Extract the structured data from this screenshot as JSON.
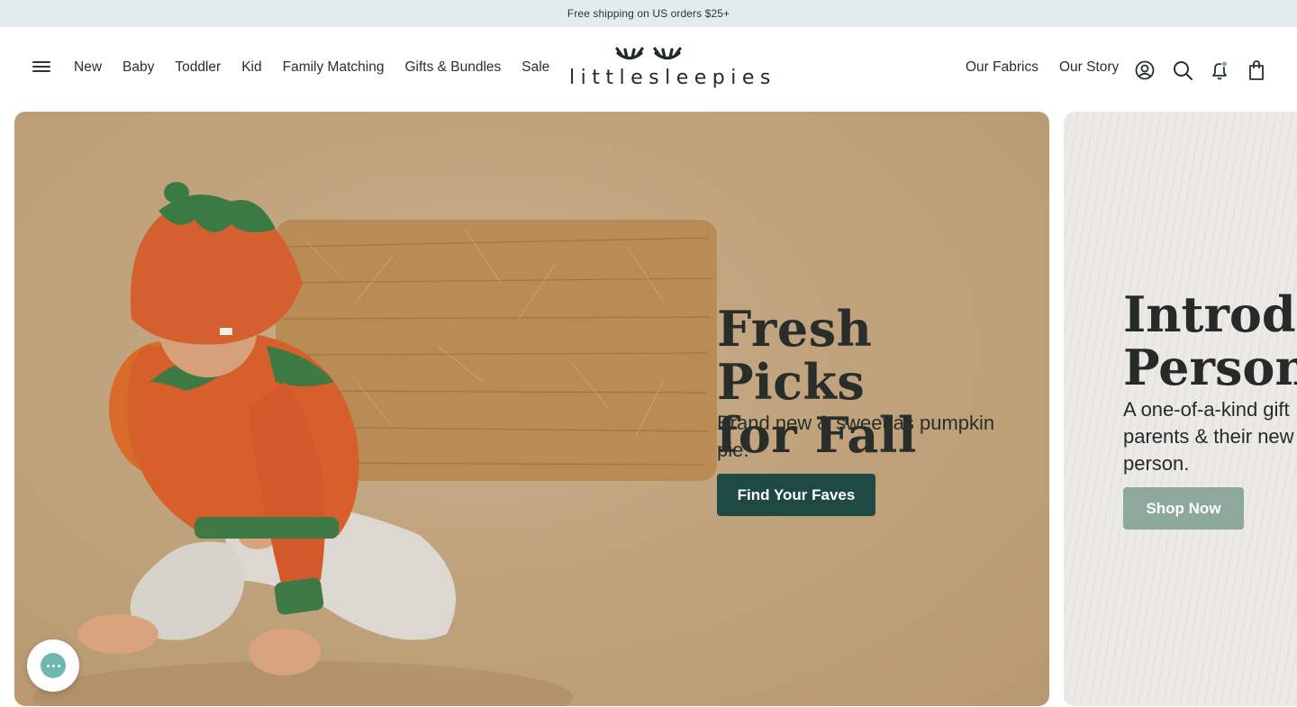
{
  "announcement": {
    "text": "Free shipping on US orders $25+"
  },
  "nav": {
    "left": [
      "New",
      "Baby",
      "Toddler",
      "Kid",
      "Family Matching",
      "Gifts & Bundles",
      "Sale"
    ],
    "right": [
      "Our Fabrics",
      "Our Story"
    ]
  },
  "logo": {
    "text": "littlesleepies"
  },
  "icons": {
    "menu": "hamburger-menu-icon",
    "account": "account-icon",
    "search": "search-icon",
    "notifications": "bell-icon",
    "cart": "shopping-bag-icon",
    "chat": "chat-icon"
  },
  "hero": {
    "title_line1": "Fresh Picks",
    "title_line2": "for Fall",
    "subtitle": "Brand new & sweet as pumpkin pie.",
    "cta": "Find Your Faves"
  },
  "next_slide": {
    "title_line1": "Introduc",
    "title_line2": "Personal",
    "subtitle": "A one-of-a-kind gift parents & their new person.",
    "cta": "Shop Now"
  },
  "colors": {
    "announcement_bg": "#e3ecec",
    "primary_cta": "#1e4a43",
    "secondary_cta": "#8ea89c",
    "hero_bg": "#c0a37d",
    "pumpkin_orange": "#d4602f",
    "leaf_green": "#3c7a44"
  }
}
